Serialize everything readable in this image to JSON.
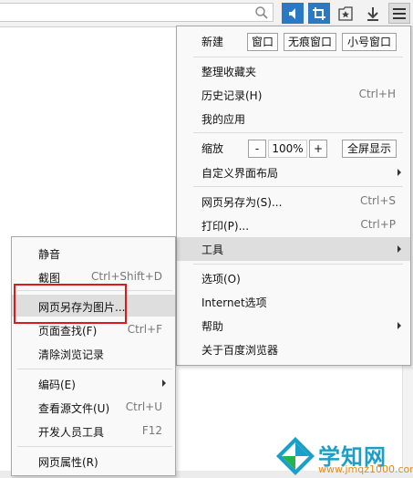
{
  "toolbar": {
    "icons": [
      "search-icon",
      "mute-icon",
      "crop-icon",
      "bookmark-star-icon",
      "download-icon",
      "menu-icon"
    ],
    "accent": "#2b78c5"
  },
  "main_menu": {
    "new_label": "新建",
    "new_window": "窗口",
    "incognito_window": "无痕窗口",
    "small_window": "小号窗口",
    "organize_bookmarks": "整理收藏夹",
    "history": {
      "label": "历史记录(H)",
      "shortcut": "Ctrl+H"
    },
    "my_apps": "我的应用",
    "zoom": {
      "label": "缩放",
      "minus": "-",
      "value": "100%",
      "plus": "+",
      "fullscreen": "全屏显示"
    },
    "custom_layout": "自定义界面布局",
    "save_as": {
      "label": "网页另存为(S)...",
      "shortcut": "Ctrl+S"
    },
    "print": {
      "label": "打印(P)...",
      "shortcut": "Ctrl+P"
    },
    "tools": "工具",
    "options": "选项(O)",
    "internet_options": "Internet选项",
    "help": "帮助",
    "about": "关于百度浏览器"
  },
  "tools_menu": {
    "mute": "静音",
    "screenshot": {
      "label": "截图",
      "shortcut": "Ctrl+Shift+D"
    },
    "save_as_image": "网页另存为图片...",
    "find": {
      "label": "页面查找(F)",
      "shortcut": "Ctrl+F"
    },
    "clear_history": "清除浏览记录",
    "encoding": "编码(E)",
    "view_source": {
      "label": "查看源文件(U)",
      "shortcut": "Ctrl+U"
    },
    "dev_tools": {
      "label": "开发人员工具",
      "shortcut": "F12"
    },
    "page_properties": "网页属性(R)"
  },
  "watermark": {
    "title": "学知网",
    "url": "www.jmqz1000.com",
    "highlight_color": "#e01818"
  }
}
